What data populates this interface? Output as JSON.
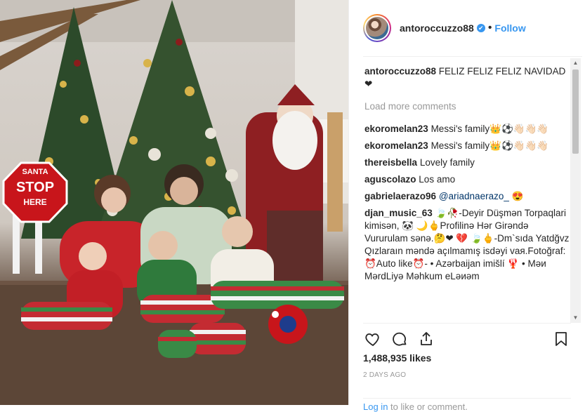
{
  "post": {
    "username": "antoroccuzzo88",
    "verified_mark": "✔",
    "follow_label": "Follow",
    "separator": "•",
    "photo_sign": {
      "line1": "SANTA",
      "line2": "STOP",
      "line3": "HERE"
    },
    "caption": {
      "user": "antoroccuzzo88",
      "text": "FELIZ FELIZ FELIZ NAVIDAD❤"
    },
    "load_more": "Load more comments",
    "comments": [
      {
        "user": "ekoromelan23",
        "text": "Messi's family👑⚽👋🏻👋🏻👋🏻"
      },
      {
        "user": "ekoromelan23",
        "text": "Messi's family👑⚽👋🏻👋🏻👋🏻"
      },
      {
        "user": "thereisbella",
        "text": "Lovely family"
      },
      {
        "user": "aguscolazo",
        "text": "Los amo"
      },
      {
        "user": "gabrielaerazo96",
        "mention": "@ariadnaerazo_",
        "text": " 😍"
      },
      {
        "user": "djan_music_63",
        "text": "🍃🥀-Deyir Düşmən Torpaqlari kimisən, 🐼 🌙🖕Profilinə Hər Girəndə Vururulam sənə.🤔❤ 💔 🍃🖕-Dm`sıda Yatdğvz Qızlaraın məndə açılmamış isdəyi vaя.Fotoğraf: ⏰Auto like⏰- • Azərbaijan imišlí 🦞 • Məи MərdLiyə Məhkum eLəиəm"
      }
    ],
    "likes": "1,488,935 likes",
    "date": "2 DAYS AGO",
    "login_link": "Log in",
    "login_text": " to like or comment."
  },
  "icons": [
    "heart-icon",
    "comment-icon",
    "share-icon",
    "bookmark-icon"
  ],
  "colors": {
    "accent": "#3897f0",
    "text": "#262626",
    "muted": "#999999",
    "border": "#efefef"
  }
}
